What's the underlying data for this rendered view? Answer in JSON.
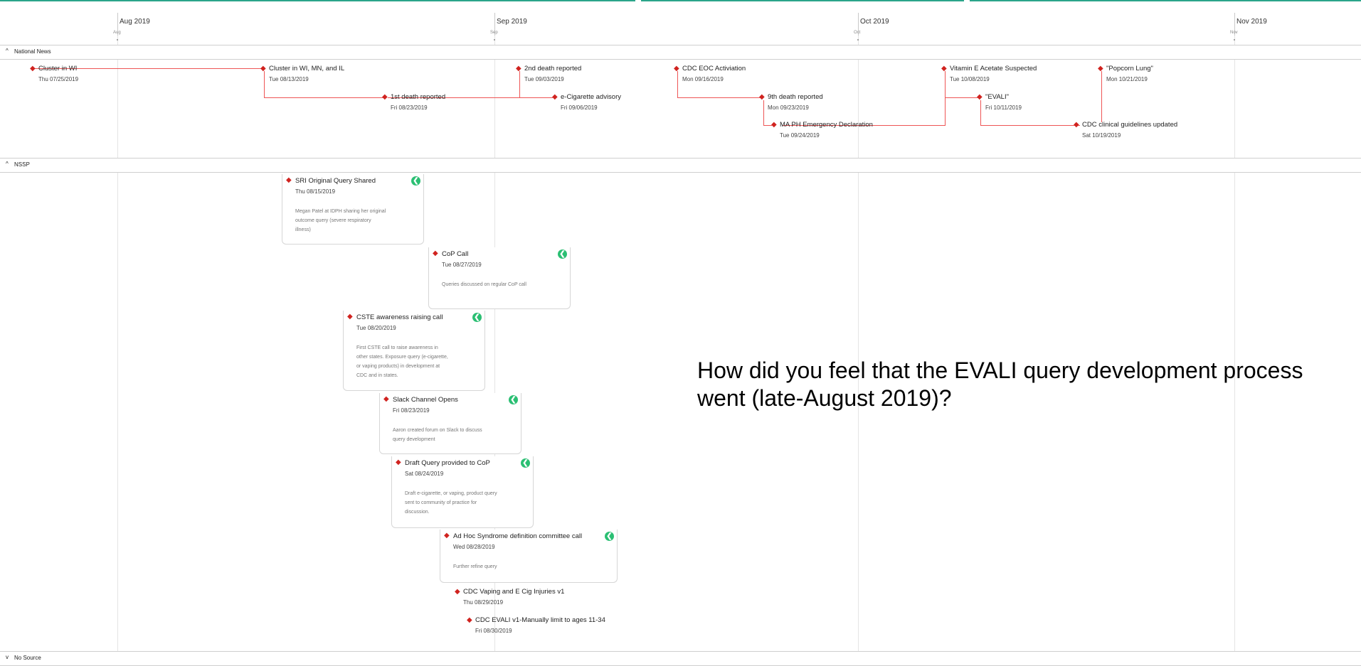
{
  "timeline": {
    "months": [
      {
        "label": "Aug 2019",
        "sub": "Aug"
      },
      {
        "label": "Sep 2019",
        "sub": "Sep"
      },
      {
        "label": "Oct 2019",
        "sub": "Oct"
      },
      {
        "label": "Nov 2019",
        "sub": "Nov"
      }
    ]
  },
  "sections": {
    "national_news": {
      "label": "National News",
      "chevron": "^"
    },
    "nssp": {
      "label": "NSSP",
      "chevron": "^"
    },
    "no_source": {
      "label": "No Source",
      "chevron": "v"
    }
  },
  "national_events": [
    {
      "title": "Cluster in WI",
      "date": "Thu 07/25/2019"
    },
    {
      "title": "Cluster in WI, MN, and IL",
      "date": "Tue 08/13/2019"
    },
    {
      "title": "1st death reported",
      "date": "Fri 08/23/2019"
    },
    {
      "title": "2nd death reported",
      "date": "Tue 09/03/2019"
    },
    {
      "title": "e-Cigarette advisory",
      "date": "Fri 09/06/2019"
    },
    {
      "title": "CDC EOC Activiation",
      "date": "Mon 09/16/2019"
    },
    {
      "title": "9th death reported",
      "date": "Mon 09/23/2019"
    },
    {
      "title": "MA PH Emergency Declaration",
      "date": "Tue 09/24/2019"
    },
    {
      "title": "Vitamin E Acetate Suspected",
      "date": "Tue 10/08/2019"
    },
    {
      "title": "\"EVALI\"",
      "date": "Fri 10/11/2019"
    },
    {
      "title": "\"Popcorn Lung\"",
      "date": "Mon 10/21/2019"
    },
    {
      "title": "CDC clinical guidelines updated",
      "date": "Sat 10/19/2019"
    }
  ],
  "nssp_cards": [
    {
      "title": "SRI Original Query Shared",
      "date": "Thu 08/15/2019",
      "desc": "Megan Patel at IDPH sharing her original outcome query (severe respiratory illness)"
    },
    {
      "title": "CoP Call",
      "date": "Tue 08/27/2019",
      "desc": "Queries discussed on regular CoP call"
    },
    {
      "title": "CSTE awareness raising call",
      "date": "Tue 08/20/2019",
      "desc": "First CSTE call to raise awareness in other states. Exposure query (e-cigarette, or vaping products) in development at CDC and in states."
    },
    {
      "title": "Slack Channel Opens",
      "date": "Fri 08/23/2019",
      "desc": "Aaron created forum on Slack to discuss query development"
    },
    {
      "title": "Draft Query provided to CoP",
      "date": "Sat 08/24/2019",
      "desc": "Draft e-cigarette, or vaping, product query sent to community of practice for discussion."
    },
    {
      "title": "Ad Hoc Syndrome definition committee call",
      "date": "Wed 08/28/2019",
      "desc": "Further refine query"
    }
  ],
  "nssp_events": [
    {
      "title": "CDC Vaping and E Cig Injuries v1",
      "date": "Thu 08/29/2019"
    },
    {
      "title": "CDC EVALI v1-Manually limit to ages 11-34",
      "date": "Fri 08/30/2019"
    }
  ],
  "badge_glyph": "❮",
  "diamond_glyph": "◆",
  "question": "How did you feel that the EVALI query development process went (late-August 2019)?",
  "colors": {
    "accent": "#2aa58a",
    "marker": "#d0231f",
    "badge": "#2bbf73"
  }
}
